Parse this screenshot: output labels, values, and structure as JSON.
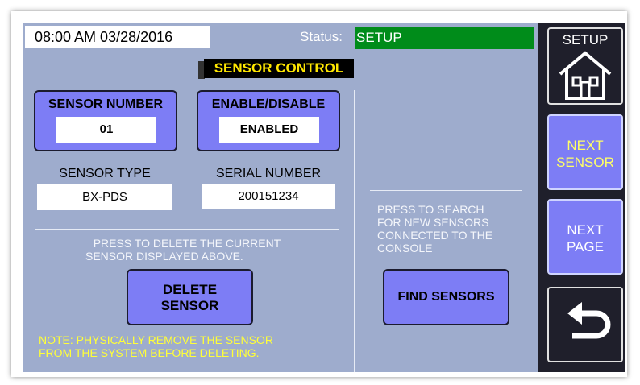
{
  "header": {
    "datetime": "08:00 AM 03/28/2016",
    "status_label": "Status:",
    "status_value": "SETUP",
    "status_color": "#008c1a"
  },
  "title": "SENSOR CONTROL",
  "sensor_number": {
    "label": "SENSOR NUMBER",
    "value": "01"
  },
  "enable_disable": {
    "label": "ENABLE/DISABLE",
    "value": "ENABLED"
  },
  "sensor_type": {
    "label": "SENSOR TYPE",
    "value": "BX-PDS"
  },
  "serial_number": {
    "label": "SERIAL NUMBER",
    "value": "200151234"
  },
  "delete_section": {
    "instructions_line1": "PRESS TO DELETE THE CURRENT",
    "instructions_line2": "SENSOR DISPLAYED ABOVE.",
    "button_line1": "DELETE",
    "button_line2": "SENSOR",
    "note_line1": "NOTE: PHYSICALLY REMOVE THE SENSOR",
    "note_line2": "FROM THE SYSTEM BEFORE DELETING."
  },
  "find_section": {
    "instructions_line1": "PRESS TO SEARCH",
    "instructions_line2": "FOR NEW SENSORS",
    "instructions_line3": "CONNECTED TO THE",
    "instructions_line4": "CONSOLE",
    "button_label": "FIND SENSORS"
  },
  "sidebar": {
    "setup_label": "SETUP",
    "setup_icon": "home-icon",
    "next_sensor_line1": "NEXT",
    "next_sensor_line2": "SENSOR",
    "next_page_line1": "NEXT",
    "next_page_line2": "PAGE",
    "back_icon": "back-arrow-icon"
  },
  "colors": {
    "panel_bg": "#9eaccd",
    "button_bg": "#7d7df5",
    "title_fg": "#ffe700",
    "note_fg": "#ffff38",
    "sidebar_bg": "#1f1f2b"
  }
}
